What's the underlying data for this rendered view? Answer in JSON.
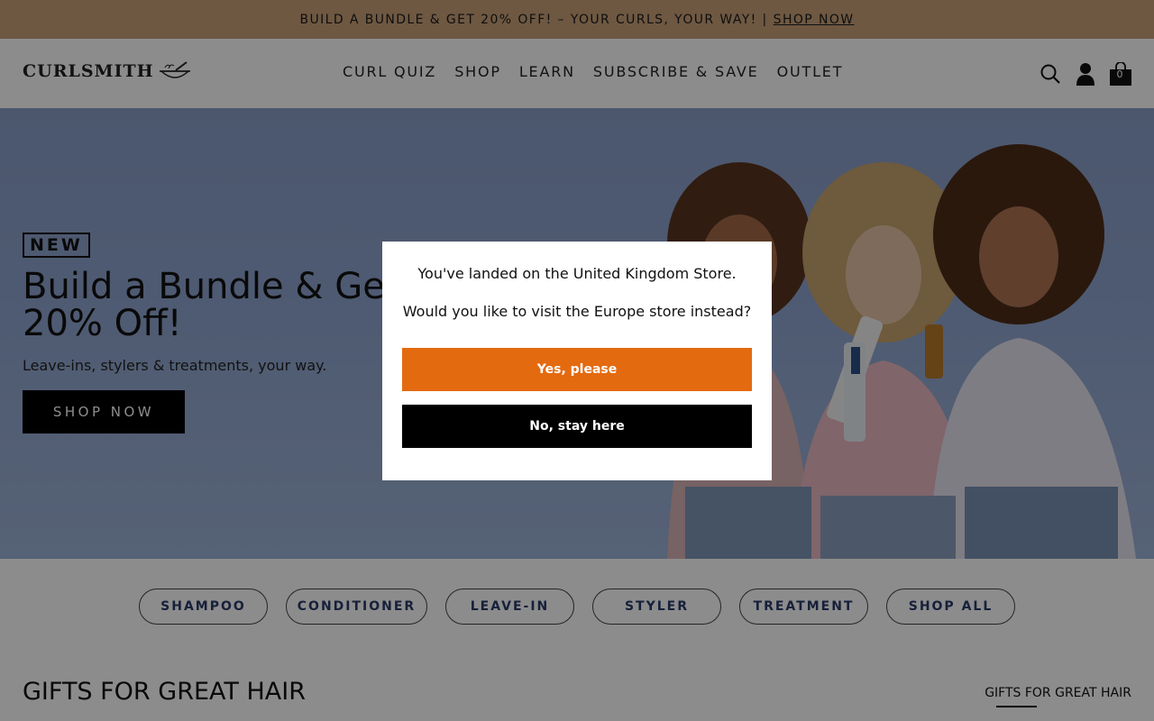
{
  "announcement": {
    "text": "BUILD A BUNDLE & GET 20% OFF! – YOUR CURLS, YOUR WAY! |",
    "link": "SHOP NOW"
  },
  "header": {
    "logo": "CURLSMITH",
    "nav": [
      "CURL QUIZ",
      "SHOP",
      "LEARN",
      "SUBSCRIBE & SAVE",
      "OUTLET"
    ],
    "cart_count": "0",
    "icons": [
      "search-icon",
      "account-icon",
      "cart-icon"
    ]
  },
  "hero": {
    "badge": "NEW",
    "title": "Build a Bundle & Get 20% Off!",
    "subtitle": "Leave-ins, stylers & treatments, your way.",
    "cta": "SHOP NOW"
  },
  "categories": [
    "SHAMPOO",
    "CONDITIONER",
    "LEAVE-IN",
    "STYLER",
    "TREATMENT",
    "SHOP ALL"
  ],
  "gifts": {
    "title": "GIFTS FOR GREAT HAIR",
    "tab": "GIFTS FOR GREAT HAIR"
  },
  "modal": {
    "line1": "You've landed on the United Kingdom Store.",
    "line2": "Would you like to visit the Europe store instead?",
    "yes": "Yes, please",
    "no": "No, stay here"
  },
  "colors": {
    "announce_bg": "#c9a178",
    "hero_bg": "#8fa5cf",
    "yes_button": "#e46a10",
    "pill_text": "#2b3b6b"
  }
}
